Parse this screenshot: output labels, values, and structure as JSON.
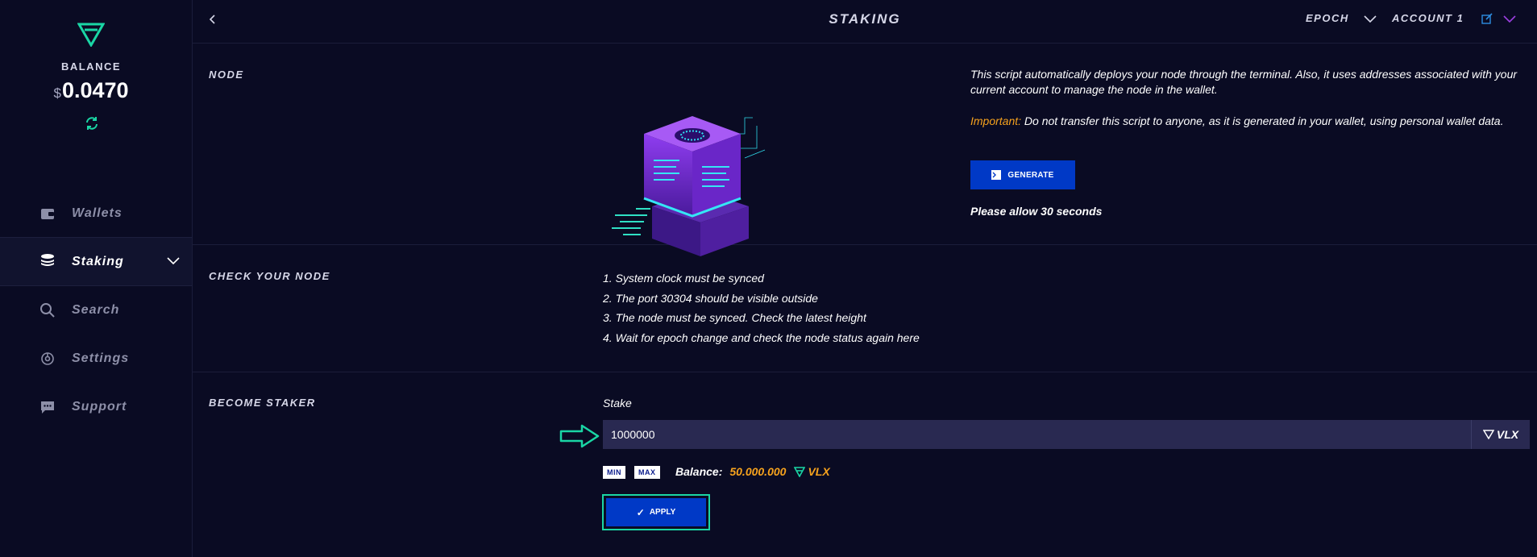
{
  "sidebar": {
    "balance_label": "BALANCE",
    "balance_currency": "$",
    "balance_value": "0.0470",
    "items": [
      {
        "label": "Wallets",
        "icon": "wallet-icon"
      },
      {
        "label": "Staking",
        "icon": "stack-icon"
      },
      {
        "label": "Search",
        "icon": "search-icon"
      },
      {
        "label": "Settings",
        "icon": "gear-icon"
      },
      {
        "label": "Support",
        "icon": "chat-icon"
      }
    ]
  },
  "header": {
    "title": "STAKING",
    "epoch_label": "EPOCH",
    "account_label": "ACCOUNT 1"
  },
  "node": {
    "title": "NODE",
    "description": "This script automatically deploys your node through the terminal. Also, it uses addresses associated with your current account to manage the node in the wallet.",
    "important_label": "Important:",
    "important_text": " Do not transfer this script to anyone, as it is generated in your wallet, using personal wallet data.",
    "generate_label": "GENERATE",
    "allow_text": "Please allow 30 seconds"
  },
  "check": {
    "title": "CHECK YOUR NODE",
    "steps": [
      "1. System clock must be synced",
      "2. The port 30304 should be visible outside",
      "3. The node must be synced. Check the latest height",
      "4. Wait for epoch change and check the node status again here"
    ]
  },
  "staker": {
    "title": "BECOME STAKER",
    "stake_label": "Stake",
    "stake_value": "1000000",
    "unit": "VLX",
    "min_label": "MIN",
    "max_label": "MAX",
    "balance_label": "Balance:",
    "balance_amount": "50.000.000",
    "balance_unit": "VLX",
    "apply_label": "APPLY"
  },
  "colors": {
    "background": "#0a0b23",
    "accent_green": "#1ad6a5",
    "button_blue": "#0039c6",
    "orange": "#f6a21d",
    "input_bg": "#292951"
  }
}
